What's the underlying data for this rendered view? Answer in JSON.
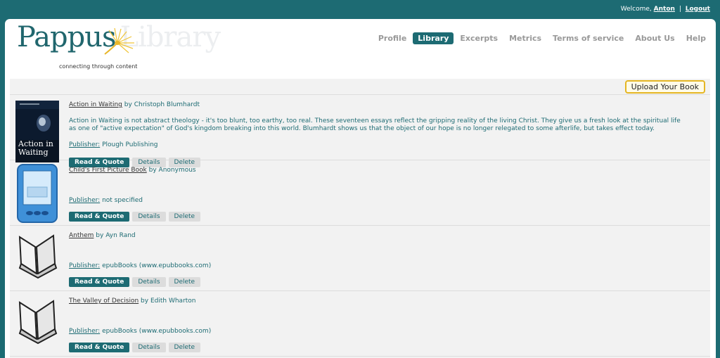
{
  "topbar": {
    "welcome": "Welcome,",
    "user": "Anton",
    "separator": "|",
    "logout": "Logout"
  },
  "logo": {
    "word1": "Pappus",
    "word2": "Library",
    "tagline": "connecting through content"
  },
  "nav": {
    "items": [
      {
        "label": "Profile"
      },
      {
        "label": "Library"
      },
      {
        "label": "Excerpts"
      },
      {
        "label": "Metrics"
      },
      {
        "label": "Terms of service"
      },
      {
        "label": "About Us"
      },
      {
        "label": "Help"
      }
    ],
    "active": "Library"
  },
  "toolbar": {
    "upload_label": "Upload Your Book"
  },
  "labels": {
    "by": "by",
    "publisher": "Publisher:",
    "read_quote": "Read & Quote",
    "details": "Details",
    "delete": "Delete"
  },
  "books": [
    {
      "title": "Action in Waiting",
      "author": "Christoph Blumhardt",
      "description": "Action in Waiting is not abstract theology - it's too blunt, too earthy, too real. These seventeen essays reflect the gripping reality of the living Christ. They give us a fresh look at the spiritual life as one of \"active expectation\" of God's kingdom breaking into this world. Blumhardt shows us that the object of our hope is no longer relegated to some afterlife, but takes effect today.",
      "publisher": "Plough Publishing",
      "cover": "book-cover-image",
      "cover_text": "Action in Waiting"
    },
    {
      "title": "Child's First Picture Book",
      "author": "Anonymous",
      "description": "",
      "publisher": "not specified",
      "cover": "ebook-reader-icon"
    },
    {
      "title": "Anthem",
      "author": "Ayn Rand",
      "description": "",
      "publisher": "epubBooks (www.epubbooks.com)",
      "cover": "open-book-icon"
    },
    {
      "title": "The Valley of Decision",
      "author": "Edith Wharton",
      "description": "",
      "publisher": "epubBooks (www.epubbooks.com)",
      "cover": "open-book-icon"
    }
  ],
  "colors": {
    "brand": "#1d6b73",
    "upload_border": "#e5b623"
  }
}
